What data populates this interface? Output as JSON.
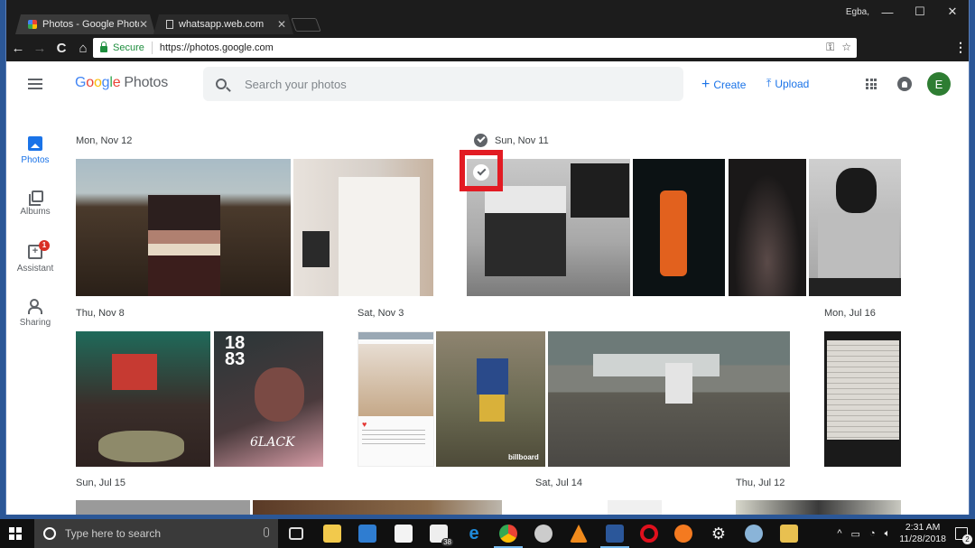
{
  "browser": {
    "tabs": [
      {
        "label": "Photos - Google Photos",
        "active": true,
        "icon": "google-photos-pinwheel-icon"
      },
      {
        "label": "whatsapp.web.com",
        "active": false,
        "icon": "document-icon"
      }
    ],
    "profile_name": "Egba,",
    "window_controls": {
      "minimize": "—",
      "maximize": "☐",
      "close": "✕"
    },
    "nav": {
      "back": "←",
      "forward": "→",
      "reload": "C",
      "home": "⌂"
    },
    "omnibox": {
      "secure_label": "Secure",
      "url": "https://photos.google.com"
    },
    "omnibox_icons": {
      "key": "⚿",
      "star": "☆"
    },
    "menu_glyph": "⋮",
    "extensions": [
      {
        "name": "blue-circle-extension-icon",
        "color": "#3aa0e8"
      },
      {
        "name": "dark-extension-icon",
        "color": "#333333"
      },
      {
        "name": "yellow-extension-icon",
        "color": "#e8b41c"
      },
      {
        "name": "magenta-extension-icon",
        "color": "#c427c4"
      }
    ]
  },
  "app": {
    "logo": {
      "letters": [
        {
          "ch": "G",
          "color": "#4285f4"
        },
        {
          "ch": "o",
          "color": "#ea4335"
        },
        {
          "ch": "o",
          "color": "#fbbc05"
        },
        {
          "ch": "g",
          "color": "#4285f4"
        },
        {
          "ch": "l",
          "color": "#34a853"
        },
        {
          "ch": "e",
          "color": "#ea4335"
        }
      ],
      "product": "Photos"
    },
    "search": {
      "placeholder": "Search your photos"
    },
    "actions": {
      "create": "Create",
      "create_glyph": "+",
      "upload": "Upload",
      "upload_glyph": "⤒"
    },
    "avatar_initial": "E",
    "accent_color": "#1a73e8",
    "sidebar": [
      {
        "label": "Photos",
        "active": true
      },
      {
        "label": "Albums",
        "active": false
      },
      {
        "label": "Assistant",
        "active": false,
        "badge": "1"
      },
      {
        "label": "Sharing",
        "active": false
      }
    ],
    "date_groups": [
      {
        "label": "Mon, Nov 12",
        "selected": false
      },
      {
        "label": "Sun, Nov 11",
        "selected": true
      },
      {
        "label": "Thu, Nov 8",
        "selected": false
      },
      {
        "label": "Sat, Nov 3",
        "selected": false
      },
      {
        "label": "Mon, Jul 16",
        "selected": false
      },
      {
        "label": "Sun, Jul 15",
        "selected": false
      },
      {
        "label": "Sat, Jul 14",
        "selected": false
      },
      {
        "label": "Thu, Jul 12",
        "selected": false
      }
    ],
    "photos": [
      {
        "group": "Mon, Nov 12",
        "desc": "Man in striped sweater on hillside"
      },
      {
        "group": "Mon, Nov 12",
        "desc": "Man in white outfit seated with sunglasses"
      },
      {
        "group": "Sun, Nov 11",
        "desc": "Black and white man sitting on floor",
        "selected": true
      },
      {
        "group": "Sun, Nov 11",
        "desc": "Performer in orange jumpsuit on stage"
      },
      {
        "group": "Sun, Nov 11",
        "desc": "Performer in smoke, dark stage"
      },
      {
        "group": "Sun, Nov 11",
        "desc": "Man with dreadlocks, grayscale portrait"
      },
      {
        "group": "Thu, Nov 8",
        "desc": "Man crouching with bags"
      },
      {
        "group": "Thu, Nov 8",
        "desc": "1883 magazine cover BLACK"
      },
      {
        "group": "Sat, Nov 3",
        "desc": "Instagram screenshot two men"
      },
      {
        "group": "Sat, Nov 3",
        "desc": "Man in Lightning jersey, billboard"
      },
      {
        "group": "Sat, Nov 3",
        "desc": "Man sitting on brick wall"
      },
      {
        "group": "Mon, Jul 16",
        "desc": "Handwritten letter"
      },
      {
        "group": "Sun, Jul 15",
        "desc": "Portrait strip"
      },
      {
        "group": "Sun, Jul 15",
        "desc": "Shelves photo"
      },
      {
        "group": "Sat, Jul 14",
        "desc": "Man in white shirt"
      },
      {
        "group": "Thu, Jul 12",
        "desc": "Person by window"
      }
    ]
  },
  "taskbar": {
    "search_placeholder": "Type here to search",
    "mail_badge": "38",
    "time": "2:31 AM",
    "date": "11/28/2018",
    "notification_count": "2",
    "tray_caret": "^"
  }
}
